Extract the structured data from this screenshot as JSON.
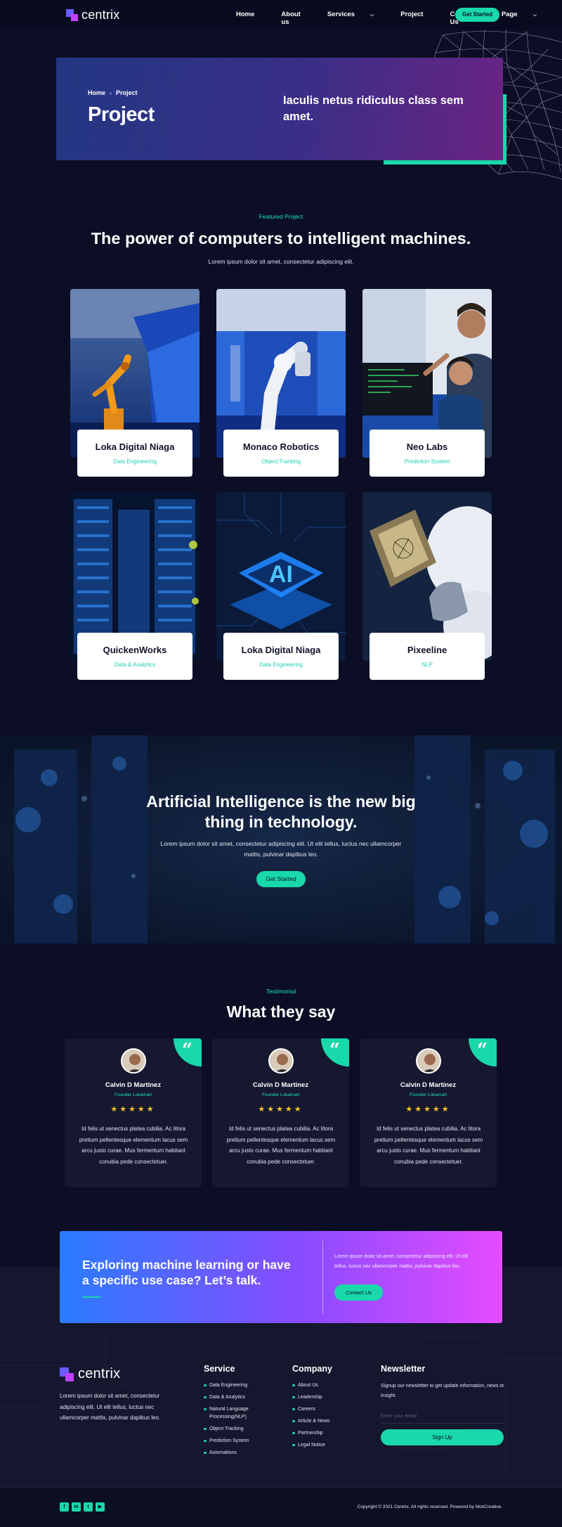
{
  "brand": {
    "name": "centrix"
  },
  "nav": {
    "items": [
      {
        "label": "Home",
        "caret": false,
        "active": false
      },
      {
        "label": "About us",
        "caret": false,
        "active": false
      },
      {
        "label": "Services",
        "caret": true,
        "active": false
      },
      {
        "label": "Project",
        "caret": false,
        "active": true
      },
      {
        "label": "Contact Us",
        "caret": false,
        "active": false
      },
      {
        "label": "Page",
        "caret": true,
        "active": false
      }
    ],
    "cta": "Get Started"
  },
  "hero": {
    "breadcrumb": [
      "Home",
      "Project"
    ],
    "title": "Project",
    "subtitle": "Iaculis netus ridiculus class sem amet."
  },
  "featured": {
    "eyebrow": "Featured Project",
    "title": "The power of computers to intelligent machines.",
    "subtitle": "Lorem ipsum dolor sit amet, consectetur adipiscing elit.",
    "projects": [
      {
        "name": "Loka Digital Niaga",
        "tag": "Data Engineering",
        "image": "robot-arm-orange"
      },
      {
        "name": "Monaco Robotics",
        "tag": "Object Tracking",
        "image": "robot-arm-white"
      },
      {
        "name": "Neo Labs",
        "tag": "Prediction System",
        "image": "engineers-lab"
      },
      {
        "name": "QuickenWorks",
        "tag": "Data & Analytics",
        "image": "server-racks"
      },
      {
        "name": "Loka Digital Niaga",
        "tag": "Data Engineering",
        "image": "ai-chip"
      },
      {
        "name": "Pixeeline",
        "tag": "NLP",
        "image": "robot-hand-chip"
      }
    ]
  },
  "ai_banner": {
    "title": "Artificial Intelligence is the new big thing in technology.",
    "text": "Lorem ipsum dolor sit amet, consectetur adipiscing elit. Ut elit tellus, luctus nec ullamcorper mattis, pulvinar dapibus leo.",
    "cta": "Get Started"
  },
  "testimonials": {
    "eyebrow": "Testimonial",
    "title": "What they say",
    "items": [
      {
        "name": "Calvin D Martinez",
        "role": "Founder Lokamart",
        "stars": 5,
        "text": "Id felis ut senectus platea cubilia. Ac litora pretium pellentesque elementum lacus sem arcu justo curae. Mus fermentum habitant conubia pede consectetuer."
      },
      {
        "name": "Calvin D Martinez",
        "role": "Founder Lokamart",
        "stars": 5,
        "text": "Id felis ut senectus platea cubilia. Ac litora pretium pellentesque elementum lacus sem arcu justo curae. Mus fermentum habitant conubia pede consectetuer."
      },
      {
        "name": "Calvin D Martinez",
        "role": "Founder Lokamart",
        "stars": 5,
        "text": "Id felis ut senectus platea cubilia. Ac litora pretium pellentesque elementum lacus sem arcu justo curae. Mus fermentum habitant conubia pede consectetuer."
      }
    ]
  },
  "talk": {
    "title": "Exploring machine learning or have a specific use case? Let’s talk.",
    "text": "Lorem ipsum dolor sit amet, consectetur adipiscing elit. Ut elit tellus, luctus nec ullamcorper mattis, pulvinar dapibus leo.",
    "cta": "Contact Us"
  },
  "footer": {
    "about": "Lorem ipsum dolor sit amet, consectetur adipiscing elit. Ut elit tellus, luctus nec ullamcorper mattis, pulvinar dapibus leo.",
    "service": {
      "title": "Service",
      "items": [
        "Data Engineering",
        "Data & Analytics",
        "Natural Language Processing(NLP)",
        "Object Tracking",
        "Prediction System",
        "Automations"
      ]
    },
    "company": {
      "title": "Company",
      "items": [
        "About Us",
        "Leadership",
        "Careers",
        "Article & News",
        "Partnership",
        "Legal Notice"
      ]
    },
    "newsletter": {
      "title": "Newsletter",
      "text": "Signup our newsletter to get update information, news or insight.",
      "placeholder": "Enter your email",
      "button": "Sign Up"
    },
    "socials": [
      {
        "icon": "facebook-icon",
        "glyph": "f"
      },
      {
        "icon": "linkedin-icon",
        "glyph": "in"
      },
      {
        "icon": "twitter-icon",
        "glyph": "t"
      },
      {
        "icon": "youtube-icon",
        "glyph": "▶"
      }
    ],
    "copyright": "Copyright © 2021 Centrix, All rights reserved. Powered by MoxCreative."
  },
  "colors": {
    "accent": "#19d8aa",
    "background": "#0b0e24",
    "stars": "#f7c32e"
  }
}
